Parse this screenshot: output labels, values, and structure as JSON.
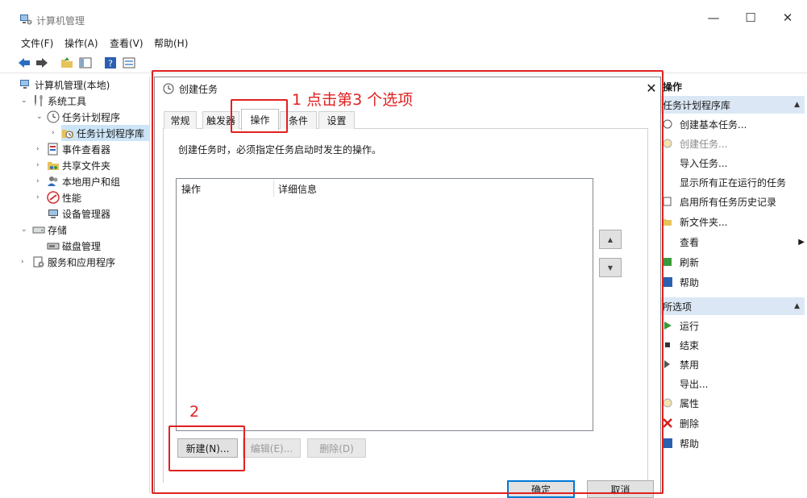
{
  "window": {
    "title": "计算机管理",
    "minimize": "—",
    "maximize": "☐",
    "close": "✕"
  },
  "menu": [
    "文件(F)",
    "操作(A)",
    "查看(V)",
    "帮助(H)"
  ],
  "tree": {
    "root": "计算机管理(本地)",
    "system_tools": "系统工具",
    "task_scheduler": "任务计划程序",
    "task_library": "任务计划程序库",
    "event_viewer": "事件查看器",
    "shared_folders": "共享文件夹",
    "local_users": "本地用户和组",
    "performance": "性能",
    "device_manager": "设备管理器",
    "storage": "存储",
    "disk_management": "磁盘管理",
    "services": "服务和应用程序"
  },
  "actions": {
    "header": "操作",
    "section1": "任务计划程序库",
    "items1": [
      "创建基本任务...",
      "创建任务...",
      "导入任务...",
      "显示所有正在运行的任务",
      "启用所有任务历史记录",
      "新文件夹...",
      "查看",
      "刷新",
      "帮助"
    ],
    "section2": "所选项",
    "items2": [
      "运行",
      "结束",
      "禁用",
      "导出...",
      "属性",
      "删除",
      "帮助"
    ]
  },
  "dialog": {
    "title": "创建任务",
    "close": "✕",
    "tabs": [
      "常规",
      "触发器",
      "操作",
      "条件",
      "设置"
    ],
    "active_tab": "操作",
    "description": "创建任务时，必须指定任务启动时发生的操作。",
    "columns": [
      "操作",
      "详细信息"
    ],
    "buttons": {
      "new": "新建(N)...",
      "edit": "编辑(E)...",
      "delete": "删除(D)"
    },
    "ok": "确定",
    "cancel": "取消"
  },
  "annotations": {
    "step1": "1 点击第3 个选项",
    "step2": "2"
  },
  "colors": {
    "accent": "#0078d7",
    "annotation": "#e02020",
    "selection": "#cce4f7",
    "header": "#dbe7f5"
  }
}
